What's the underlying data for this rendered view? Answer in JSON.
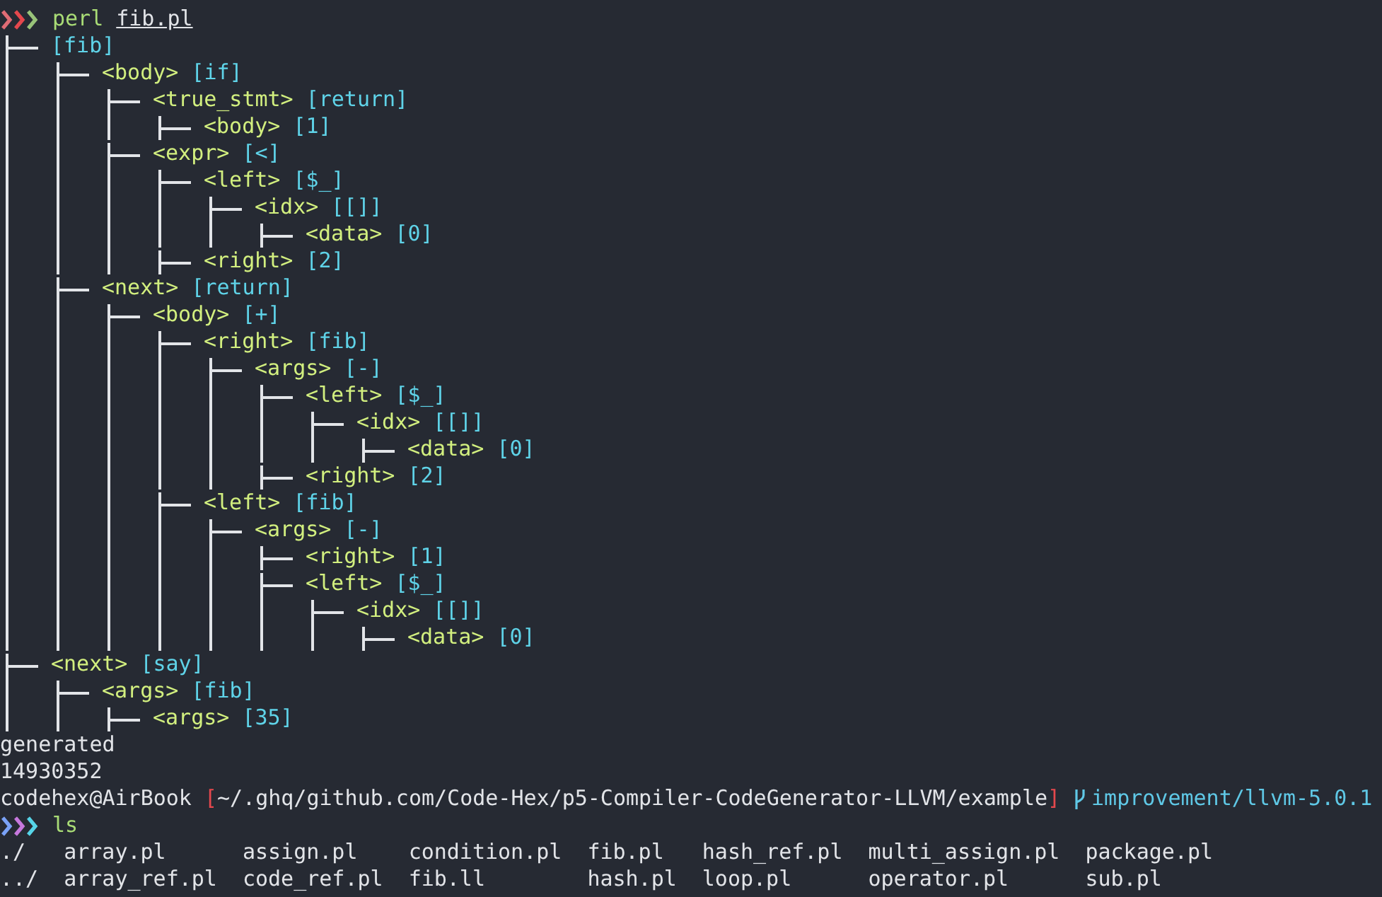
{
  "first_command": {
    "program": "perl",
    "argument": "fib.pl"
  },
  "tree": [
    {
      "value": "[fib]",
      "children": [
        {
          "label": "<body>",
          "value": "[if]",
          "children": [
            {
              "label": "<true_stmt>",
              "value": "[return]",
              "children": [
                {
                  "label": "<body>",
                  "value": "[1]"
                }
              ]
            },
            {
              "label": "<expr>",
              "value": "[<]",
              "children": [
                {
                  "label": "<left>",
                  "value": "[$_]",
                  "children": [
                    {
                      "label": "<idx>",
                      "value": "[[]]",
                      "children": [
                        {
                          "label": "<data>",
                          "value": "[0]"
                        }
                      ]
                    }
                  ]
                },
                {
                  "label": "<right>",
                  "value": "[2]"
                }
              ]
            }
          ]
        },
        {
          "label": "<next>",
          "value": "[return]",
          "children": [
            {
              "label": "<body>",
              "value": "[+]",
              "children": [
                {
                  "label": "<right>",
                  "value": "[fib]",
                  "children": [
                    {
                      "label": "<args>",
                      "value": "[-]",
                      "children": [
                        {
                          "label": "<left>",
                          "value": "[$_]",
                          "children": [
                            {
                              "label": "<idx>",
                              "value": "[[]]",
                              "children": [
                                {
                                  "label": "<data>",
                                  "value": "[0]"
                                }
                              ]
                            }
                          ]
                        },
                        {
                          "label": "<right>",
                          "value": "[2]"
                        }
                      ]
                    }
                  ]
                },
                {
                  "label": "<left>",
                  "value": "[fib]",
                  "children": [
                    {
                      "label": "<args>",
                      "value": "[-]",
                      "children": [
                        {
                          "label": "<right>",
                          "value": "[1]"
                        },
                        {
                          "label": "<left>",
                          "value": "[$_]",
                          "children": [
                            {
                              "label": "<idx>",
                              "value": "[[]]",
                              "children": [
                                {
                                  "label": "<data>",
                                  "value": "[0]"
                                }
                              ]
                            }
                          ]
                        }
                      ]
                    }
                  ]
                }
              ]
            }
          ]
        }
      ]
    },
    {
      "label": "<next>",
      "value": "[say]",
      "children": [
        {
          "label": "<args>",
          "value": "[fib]",
          "children": [
            {
              "label": "<args>",
              "value": "[35]"
            }
          ]
        }
      ]
    }
  ],
  "output": [
    "generated",
    "14930352"
  ],
  "prompt": {
    "user": "codehex@AirBook",
    "bracket_open": "[",
    "path": "~/.ghq/github.com/Code-Hex/p5-Compiler-CodeGenerator-LLVM/example",
    "bracket_close": "]",
    "branch": "improvement/llvm-5.0.1"
  },
  "second_command": {
    "program": "ls"
  },
  "ls_columns": [
    [
      "./",
      "../"
    ],
    [
      "array.pl",
      "array_ref.pl"
    ],
    [
      "assign.pl",
      "code_ref.pl"
    ],
    [
      "condition.pl",
      "fib.ll"
    ],
    [
      "fib.pl",
      "hash.pl"
    ],
    [
      "hash_ref.pl",
      "loop.pl"
    ],
    [
      "multi_assign.pl",
      "operator.pl"
    ],
    [
      "package.pl",
      "sub.pl"
    ]
  ]
}
